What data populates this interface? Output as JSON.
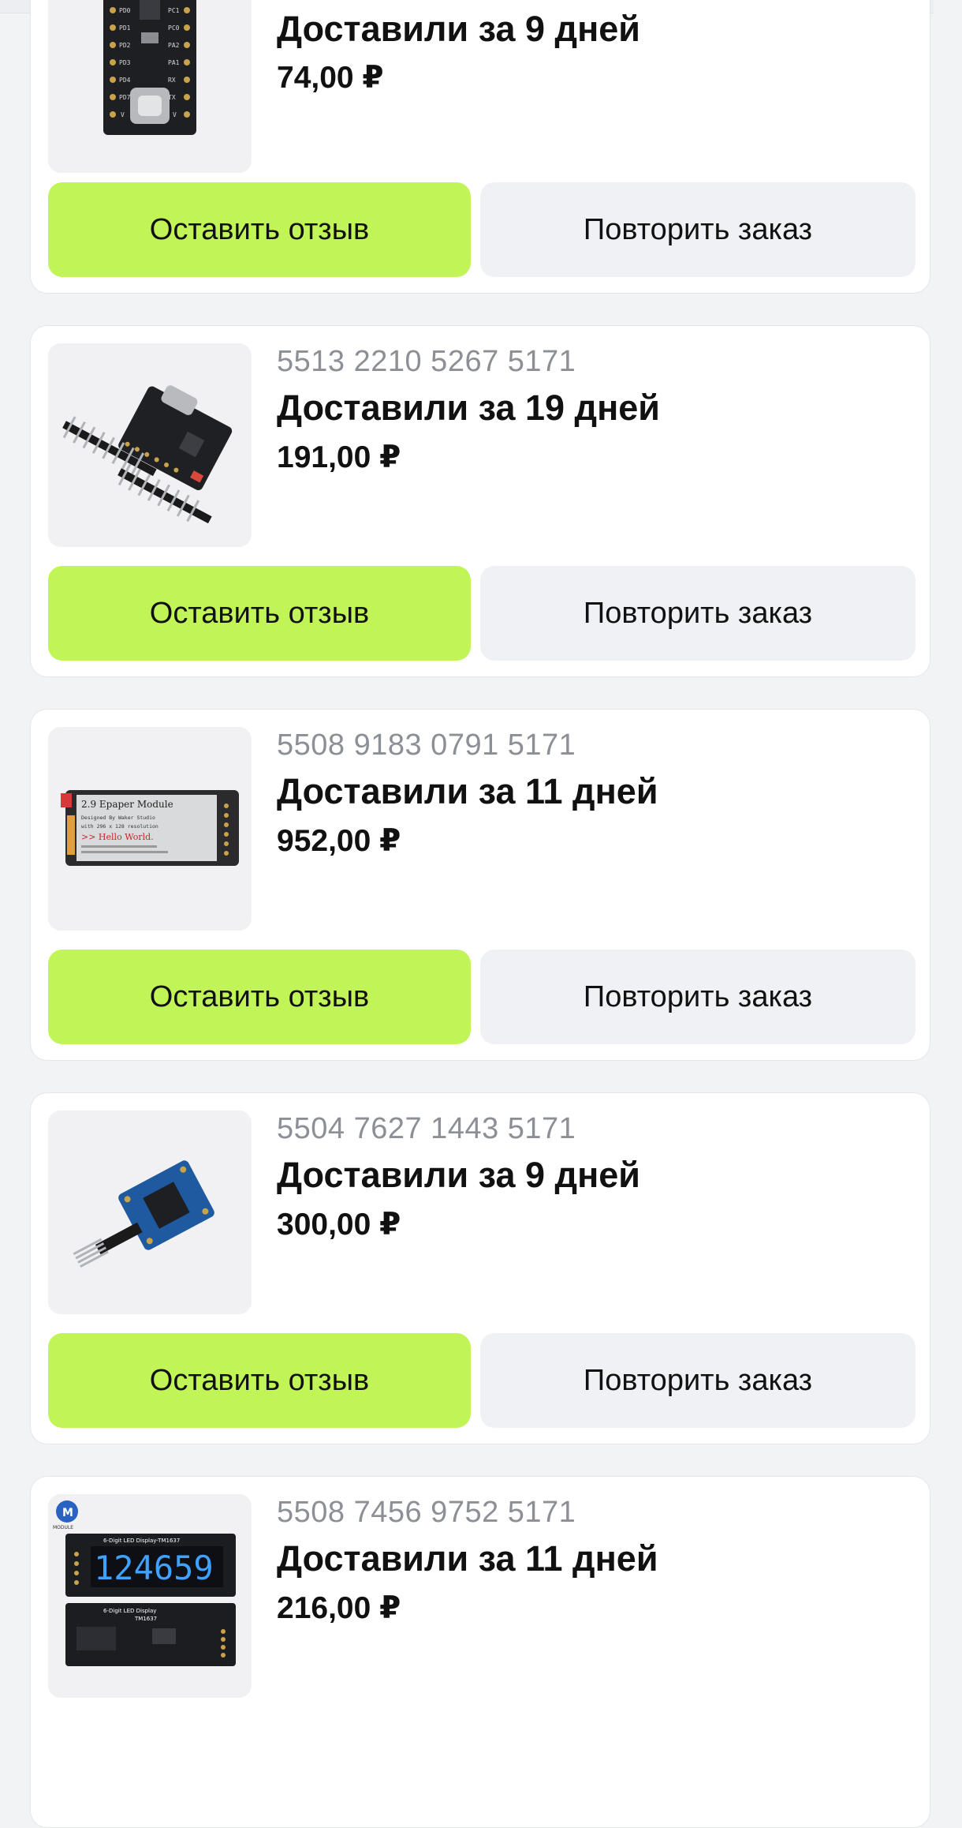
{
  "orders": [
    {
      "order_number": "",
      "delivery_text": "Доставили за 9 дней",
      "price": "74,00 ₽",
      "product_image": "usb-c-dev-board-black-icon",
      "review_label": "Оставить отзыв",
      "repeat_label": "Повторить заказ"
    },
    {
      "order_number": "5513 2210 5267 5171",
      "delivery_text": "Доставили за 19 дней",
      "price": "191,00 ₽",
      "product_image": "usb-c-mini-board-with-pin-headers-icon",
      "review_label": "Оставить отзыв",
      "repeat_label": "Повторить заказ"
    },
    {
      "order_number": "5508 9183 0791 5171",
      "delivery_text": "Доставили за 11 дней",
      "price": "952,00 ₽",
      "product_image": "epaper-module-icon",
      "product_image_text": [
        "2.9 Epaper Module",
        "Designed By Waker Studio",
        "with 296 x 128 resolution",
        ">> Hello World."
      ],
      "review_label": "Оставить отзыв",
      "repeat_label": "Повторить заказ"
    },
    {
      "order_number": "5504 7627 1443 5171",
      "delivery_text": "Доставили за 9 дней",
      "price": "300,00 ₽",
      "product_image": "blue-sensor-module-icon",
      "review_label": "Оставить отзыв",
      "repeat_label": "Повторить заказ"
    },
    {
      "order_number": "5508 7456 9752 5171",
      "delivery_text": "Доставили за 11 дней",
      "price": "216,00 ₽",
      "product_image": "led-display-module-icon",
      "product_image_text": [
        "MODULE",
        "6-Digit LED Display-TM1637",
        "124659",
        "6-Digit LED Display",
        "TM1637"
      ],
      "review_label": "Оставить отзыв",
      "repeat_label": "Повторить заказ"
    }
  ],
  "colors": {
    "review_button": "#c1f457",
    "repeat_button": "#eff1f5",
    "order_number": "#8c8f96",
    "card_background": "#ffffff",
    "page_background": "#f2f3f5"
  }
}
